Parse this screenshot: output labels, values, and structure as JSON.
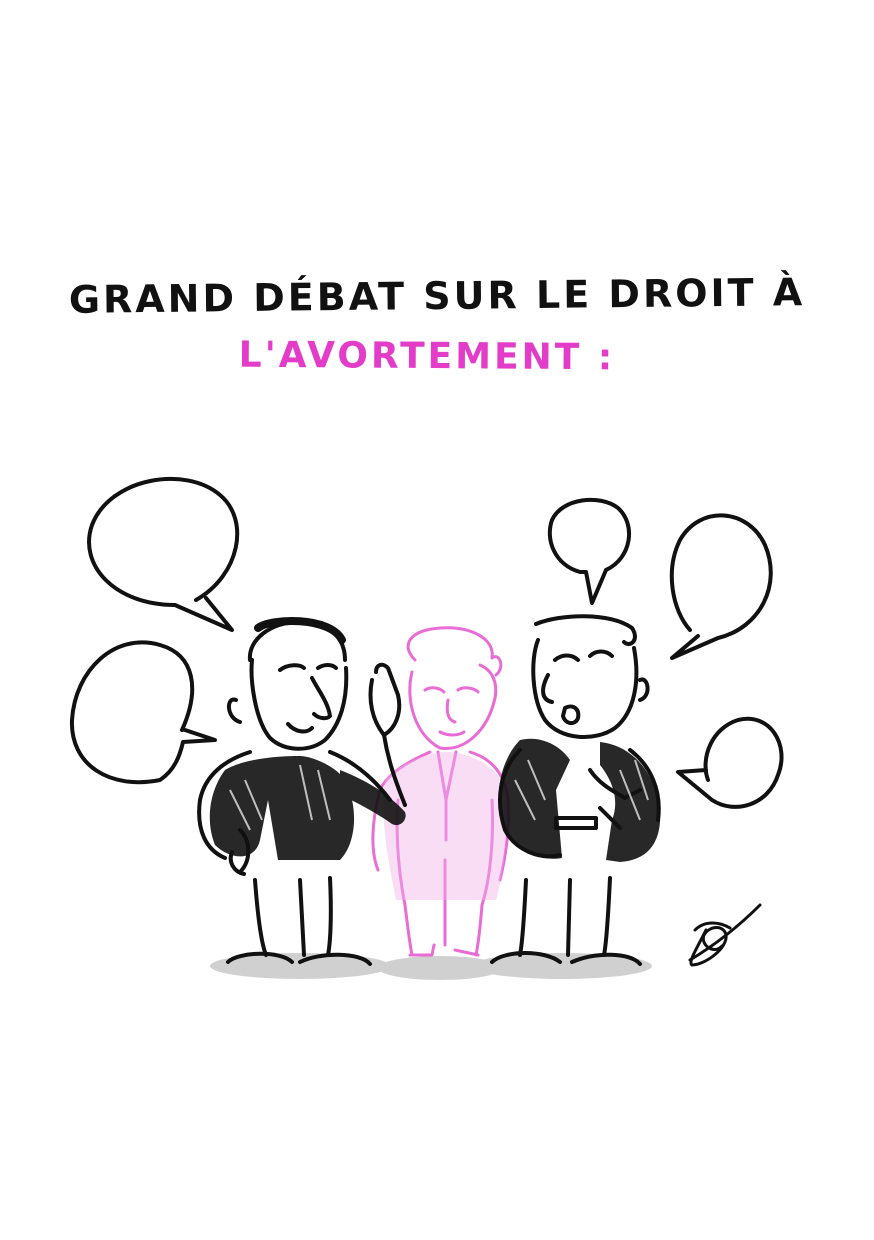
{
  "title": {
    "line1": "GRAND DÉBAT SUR LE DROIT À",
    "line2": "L'AVORTEMENT :"
  },
  "colors": {
    "ink": "#111111",
    "accent": "#e23cc8",
    "shadow": "#c8c8c8",
    "accent_light": "#f2b3e8"
  },
  "icons": {
    "signature": "signature-icon",
    "speech_bubble": "speech-bubble-icon"
  }
}
